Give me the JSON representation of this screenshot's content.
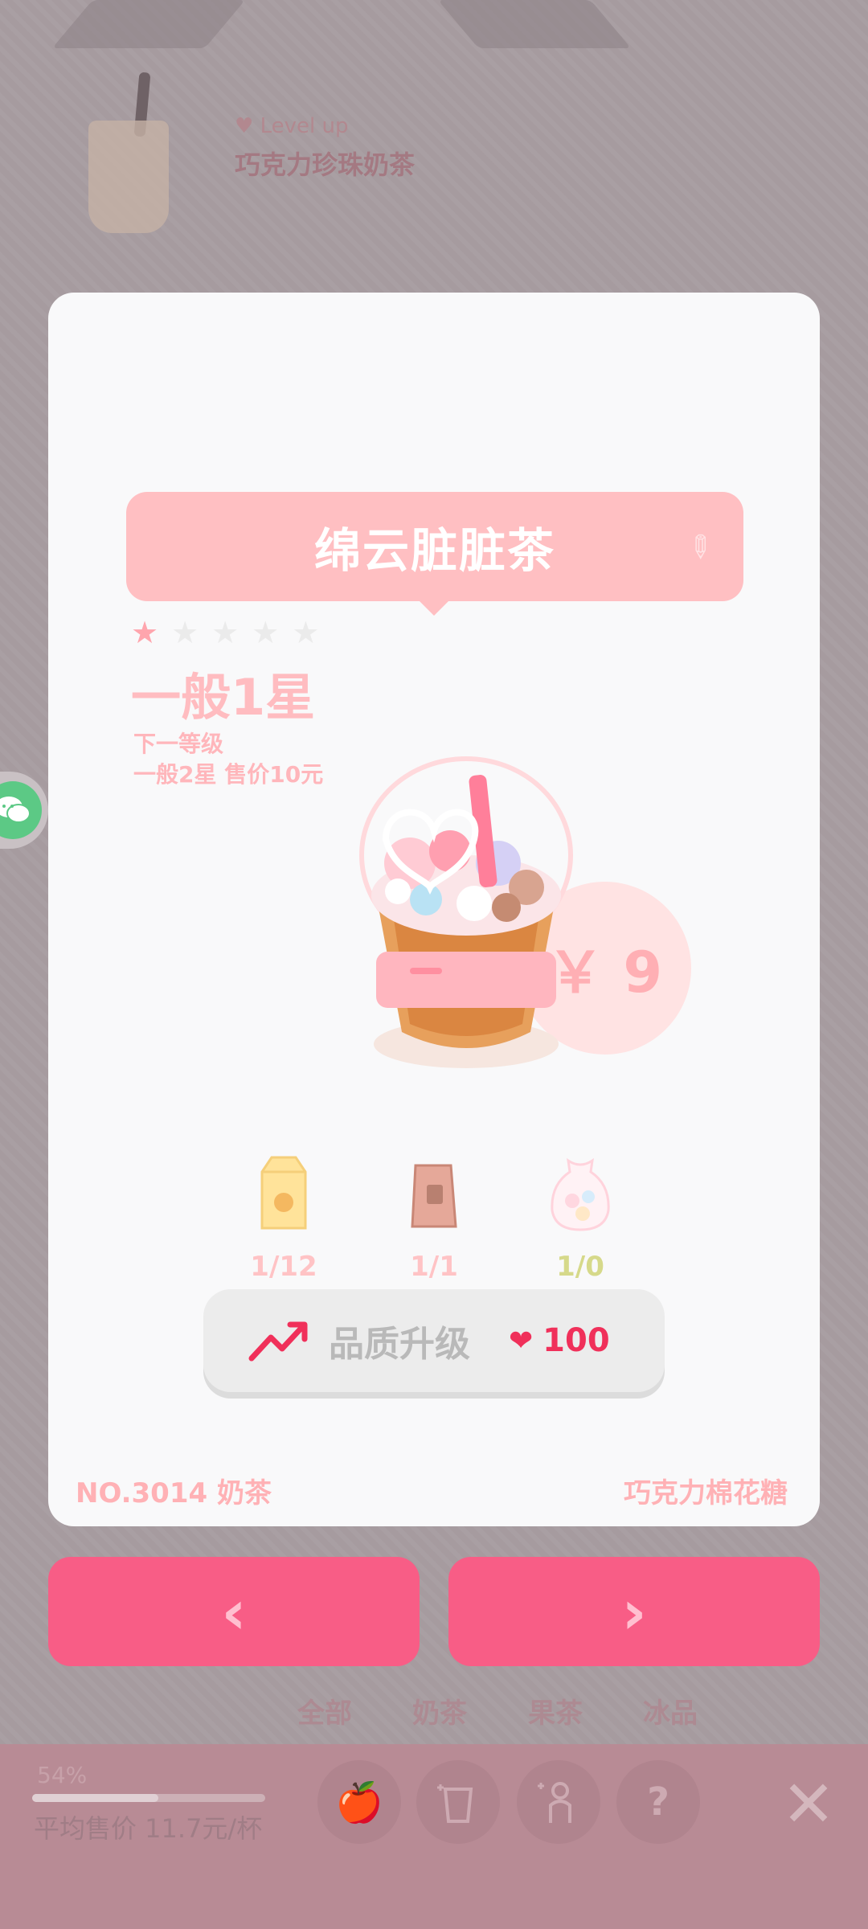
{
  "background": {
    "level_up_label": "Level up",
    "drink_name": "巧克力珍珠奶茶",
    "tabs": [
      "全部",
      "奶茶",
      "果茶",
      "冰品"
    ],
    "progress_percent_text": "54%",
    "progress_value": 0.54,
    "avg_price": "平均售价 11.7元/杯",
    "tools": [
      "apple-icon",
      "cup-plus-icon",
      "person-plus-icon",
      "question-icon"
    ]
  },
  "modal": {
    "drink_name": "绵云脏脏茶",
    "stars_filled": 1,
    "stars_total": 5,
    "level_title": "一般1星",
    "next_label": "下一等级",
    "next_info": "一般2星 售价10元",
    "price": "￥ 9",
    "ingredients": [
      {
        "icon": "milk-carton-icon",
        "count": "1/12",
        "color": "#ffc3c5"
      },
      {
        "icon": "tea-bag-icon",
        "count": "1/1",
        "color": "#ffc3c5"
      },
      {
        "icon": "marshmallow-bag-icon",
        "count": "1/0",
        "color": "#d6d98a"
      }
    ],
    "upgrade_label": "品质升级",
    "upgrade_cost": "100",
    "drink_number": "NO.3014 奶茶",
    "drink_sub": "巧克力棉花糖"
  },
  "nav": {
    "prev": "‹",
    "next": "›"
  },
  "colors": {
    "accent": "#f85d86",
    "banner": "#ffbfc2",
    "heart": "#f0305a"
  }
}
